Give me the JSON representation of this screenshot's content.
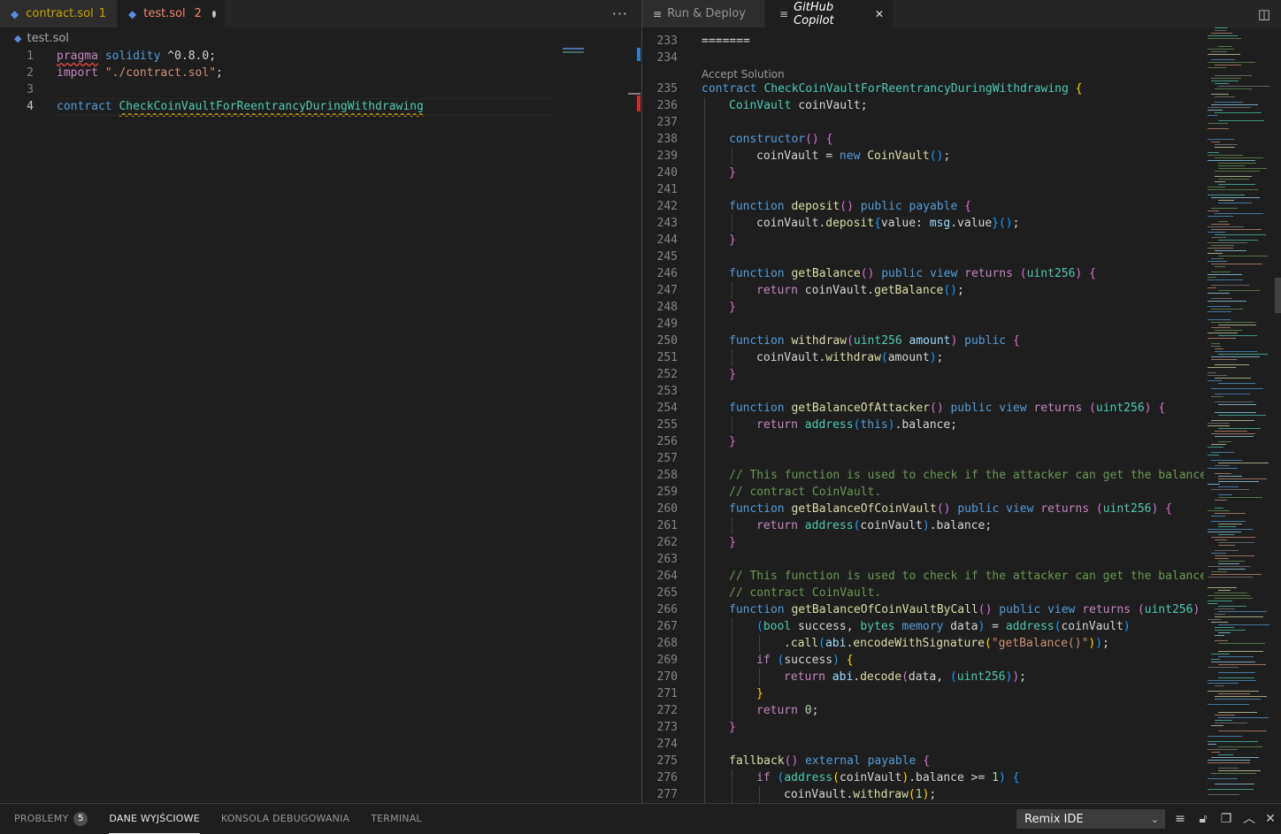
{
  "left_group": {
    "tabs": [
      {
        "label": "contract.sol",
        "count": "1",
        "active": false
      },
      {
        "label": "test.sol",
        "count": "2",
        "active": true
      }
    ],
    "more_actions": "···",
    "breadcrumb": "test.sol",
    "lines": [
      {
        "n": "1",
        "tokens": [
          [
            "kw2 squiggle-red",
            "pragma"
          ],
          [
            "plain",
            " "
          ],
          [
            "kw",
            "solidity"
          ],
          [
            "plain",
            " ^0.8.0;"
          ]
        ]
      },
      {
        "n": "2",
        "tokens": [
          [
            "kw2",
            "import"
          ],
          [
            "plain",
            " "
          ],
          [
            "str",
            "\"./contract.sol\""
          ],
          [
            "plain",
            ";"
          ]
        ]
      },
      {
        "n": "3",
        "tokens": []
      },
      {
        "n": "4",
        "tokens": [
          [
            "kw",
            "contract"
          ],
          [
            "plain",
            " "
          ],
          [
            "ty squiggle-yel",
            "CheckCoinVaultForReentrancyDuringWithdrawing"
          ]
        ]
      }
    ]
  },
  "right_group": {
    "tabs": [
      {
        "label": "Run & Deploy"
      },
      {
        "label": "GitHub Copilot"
      }
    ],
    "close_glyph": "✕",
    "split_glyph": "◫",
    "codelens": "Accept Solution",
    "lines": [
      {
        "n": "233",
        "i": 0,
        "tokens": [
          [
            "plain",
            "======="
          ]
        ]
      },
      {
        "n": "234",
        "i": 0,
        "tokens": []
      },
      {
        "n": "235",
        "i": 0,
        "tokens": [
          [
            "kw",
            "contract"
          ],
          [
            "plain",
            " "
          ],
          [
            "ty",
            "CheckCoinVaultForReentrancyDuringWithdrawing"
          ],
          [
            "plain",
            " "
          ],
          [
            "br1",
            "{"
          ]
        ]
      },
      {
        "n": "236",
        "i": 1,
        "tokens": [
          [
            "ty",
            "CoinVault"
          ],
          [
            "plain",
            " coinVault;"
          ]
        ]
      },
      {
        "n": "237",
        "i": 1,
        "tokens": []
      },
      {
        "n": "238",
        "i": 1,
        "tokens": [
          [
            "kw",
            "constructor"
          ],
          [
            "br2",
            "()"
          ],
          [
            "plain",
            " "
          ],
          [
            "br2",
            "{"
          ]
        ]
      },
      {
        "n": "239",
        "i": 2,
        "tokens": [
          [
            "plain",
            "coinVault = "
          ],
          [
            "kw",
            "new"
          ],
          [
            "plain",
            " "
          ],
          [
            "fn",
            "CoinVault"
          ],
          [
            "br3",
            "()"
          ],
          [
            "plain",
            ";"
          ]
        ]
      },
      {
        "n": "240",
        "i": 1,
        "tokens": [
          [
            "br2",
            "}"
          ]
        ]
      },
      {
        "n": "241",
        "i": 1,
        "tokens": []
      },
      {
        "n": "242",
        "i": 1,
        "tokens": [
          [
            "kw",
            "function"
          ],
          [
            "plain",
            " "
          ],
          [
            "fn",
            "deposit"
          ],
          [
            "br2",
            "()"
          ],
          [
            "plain",
            " "
          ],
          [
            "kw",
            "public"
          ],
          [
            "plain",
            " "
          ],
          [
            "kw",
            "payable"
          ],
          [
            "plain",
            " "
          ],
          [
            "br2",
            "{"
          ]
        ]
      },
      {
        "n": "243",
        "i": 2,
        "tokens": [
          [
            "plain",
            "coinVault."
          ],
          [
            "fn",
            "deposit"
          ],
          [
            "br3",
            "{"
          ],
          [
            "plain",
            "value: "
          ],
          [
            "var",
            "msg"
          ],
          [
            "plain",
            ".value"
          ],
          [
            "br3",
            "}"
          ],
          [
            "br3",
            "()"
          ],
          [
            "plain",
            ";"
          ]
        ]
      },
      {
        "n": "244",
        "i": 1,
        "tokens": [
          [
            "br2",
            "}"
          ]
        ]
      },
      {
        "n": "245",
        "i": 1,
        "tokens": []
      },
      {
        "n": "246",
        "i": 1,
        "tokens": [
          [
            "kw",
            "function"
          ],
          [
            "plain",
            " "
          ],
          [
            "fn",
            "getBalance"
          ],
          [
            "br2",
            "()"
          ],
          [
            "plain",
            " "
          ],
          [
            "kw",
            "public"
          ],
          [
            "plain",
            " "
          ],
          [
            "kw",
            "view"
          ],
          [
            "plain",
            " "
          ],
          [
            "kw2",
            "returns"
          ],
          [
            "plain",
            " "
          ],
          [
            "br2",
            "("
          ],
          [
            "ty",
            "uint256"
          ],
          [
            "br2",
            ")"
          ],
          [
            "plain",
            " "
          ],
          [
            "br2",
            "{"
          ]
        ]
      },
      {
        "n": "247",
        "i": 2,
        "tokens": [
          [
            "kw2",
            "return"
          ],
          [
            "plain",
            " coinVault."
          ],
          [
            "fn",
            "getBalance"
          ],
          [
            "br3",
            "()"
          ],
          [
            "plain",
            ";"
          ]
        ]
      },
      {
        "n": "248",
        "i": 1,
        "tokens": [
          [
            "br2",
            "}"
          ]
        ]
      },
      {
        "n": "249",
        "i": 1,
        "tokens": []
      },
      {
        "n": "250",
        "i": 1,
        "tokens": [
          [
            "kw",
            "function"
          ],
          [
            "plain",
            " "
          ],
          [
            "fn",
            "withdraw"
          ],
          [
            "br2",
            "("
          ],
          [
            "ty",
            "uint256"
          ],
          [
            "plain",
            " "
          ],
          [
            "var",
            "amount"
          ],
          [
            "br2",
            ")"
          ],
          [
            "plain",
            " "
          ],
          [
            "kw",
            "public"
          ],
          [
            "plain",
            " "
          ],
          [
            "br2",
            "{"
          ]
        ]
      },
      {
        "n": "251",
        "i": 2,
        "tokens": [
          [
            "plain",
            "coinVault."
          ],
          [
            "fn",
            "withdraw"
          ],
          [
            "br3",
            "("
          ],
          [
            "plain",
            "amount"
          ],
          [
            "br3",
            ")"
          ],
          [
            "plain",
            ";"
          ]
        ]
      },
      {
        "n": "252",
        "i": 1,
        "tokens": [
          [
            "br2",
            "}"
          ]
        ]
      },
      {
        "n": "253",
        "i": 1,
        "tokens": []
      },
      {
        "n": "254",
        "i": 1,
        "tokens": [
          [
            "kw",
            "function"
          ],
          [
            "plain",
            " "
          ],
          [
            "fn",
            "getBalanceOfAttacker"
          ],
          [
            "br2",
            "()"
          ],
          [
            "plain",
            " "
          ],
          [
            "kw",
            "public"
          ],
          [
            "plain",
            " "
          ],
          [
            "kw",
            "view"
          ],
          [
            "plain",
            " "
          ],
          [
            "kw2",
            "returns"
          ],
          [
            "plain",
            " "
          ],
          [
            "br2",
            "("
          ],
          [
            "ty",
            "uint256"
          ],
          [
            "br2",
            ")"
          ],
          [
            "plain",
            " "
          ],
          [
            "br2",
            "{"
          ]
        ]
      },
      {
        "n": "255",
        "i": 2,
        "tokens": [
          [
            "kw2",
            "return"
          ],
          [
            "plain",
            " "
          ],
          [
            "ty",
            "address"
          ],
          [
            "br3",
            "("
          ],
          [
            "kw",
            "this"
          ],
          [
            "br3",
            ")"
          ],
          [
            "plain",
            ".balance;"
          ]
        ]
      },
      {
        "n": "256",
        "i": 1,
        "tokens": [
          [
            "br2",
            "}"
          ]
        ]
      },
      {
        "n": "257",
        "i": 1,
        "tokens": []
      },
      {
        "n": "258",
        "i": 1,
        "tokens": [
          [
            "cm",
            "// This function is used to check if the attacker can get the balance of the"
          ]
        ]
      },
      {
        "n": "259",
        "i": 1,
        "tokens": [
          [
            "cm",
            "// contract CoinVault."
          ]
        ]
      },
      {
        "n": "260",
        "i": 1,
        "tokens": [
          [
            "kw",
            "function"
          ],
          [
            "plain",
            " "
          ],
          [
            "fn",
            "getBalanceOfCoinVault"
          ],
          [
            "br2",
            "()"
          ],
          [
            "plain",
            " "
          ],
          [
            "kw",
            "public"
          ],
          [
            "plain",
            " "
          ],
          [
            "kw",
            "view"
          ],
          [
            "plain",
            " "
          ],
          [
            "kw2",
            "returns"
          ],
          [
            "plain",
            " "
          ],
          [
            "br2",
            "("
          ],
          [
            "ty",
            "uint256"
          ],
          [
            "br2",
            ")"
          ],
          [
            "plain",
            " "
          ],
          [
            "br2",
            "{"
          ]
        ]
      },
      {
        "n": "261",
        "i": 2,
        "tokens": [
          [
            "kw2",
            "return"
          ],
          [
            "plain",
            " "
          ],
          [
            "ty",
            "address"
          ],
          [
            "br3",
            "("
          ],
          [
            "plain",
            "coinVault"
          ],
          [
            "br3",
            ")"
          ],
          [
            "plain",
            ".balance;"
          ]
        ]
      },
      {
        "n": "262",
        "i": 1,
        "tokens": [
          [
            "br2",
            "}"
          ]
        ]
      },
      {
        "n": "263",
        "i": 1,
        "tokens": []
      },
      {
        "n": "264",
        "i": 1,
        "tokens": [
          [
            "cm",
            "// This function is used to check if the attacker can get the balance of the"
          ]
        ]
      },
      {
        "n": "265",
        "i": 1,
        "tokens": [
          [
            "cm",
            "// contract CoinVault."
          ]
        ]
      },
      {
        "n": "266",
        "i": 1,
        "tokens": [
          [
            "kw",
            "function"
          ],
          [
            "plain",
            " "
          ],
          [
            "fn",
            "getBalanceOfCoinVaultByCall"
          ],
          [
            "br2",
            "()"
          ],
          [
            "plain",
            " "
          ],
          [
            "kw",
            "public"
          ],
          [
            "plain",
            " "
          ],
          [
            "kw",
            "view"
          ],
          [
            "plain",
            " "
          ],
          [
            "kw2",
            "returns"
          ],
          [
            "plain",
            " "
          ],
          [
            "br2",
            "("
          ],
          [
            "ty",
            "uint256"
          ],
          [
            "br2",
            ")"
          ],
          [
            "plain",
            " "
          ],
          [
            "br2",
            "{"
          ]
        ]
      },
      {
        "n": "267",
        "i": 2,
        "tokens": [
          [
            "br3",
            "("
          ],
          [
            "ty",
            "bool"
          ],
          [
            "plain",
            " success, "
          ],
          [
            "ty",
            "bytes"
          ],
          [
            "plain",
            " "
          ],
          [
            "kw",
            "memory"
          ],
          [
            "plain",
            " data"
          ],
          [
            "br3",
            ")"
          ],
          [
            "plain",
            " = "
          ],
          [
            "ty",
            "address"
          ],
          [
            "br3",
            "("
          ],
          [
            "plain",
            "coinVault"
          ],
          [
            "br3",
            ")"
          ]
        ]
      },
      {
        "n": "268",
        "i": 3,
        "tokens": [
          [
            "plain",
            "."
          ],
          [
            "fn",
            "call"
          ],
          [
            "br3",
            "("
          ],
          [
            "var",
            "abi"
          ],
          [
            "plain",
            "."
          ],
          [
            "fn",
            "encodeWithSignature"
          ],
          [
            "br1",
            "("
          ],
          [
            "str",
            "\"getBalance()\""
          ],
          [
            "br1",
            ")"
          ],
          [
            "br3",
            ")"
          ],
          [
            "plain",
            ";"
          ]
        ]
      },
      {
        "n": "269",
        "i": 2,
        "tokens": [
          [
            "kw2",
            "if"
          ],
          [
            "plain",
            " "
          ],
          [
            "br3",
            "("
          ],
          [
            "plain",
            "success"
          ],
          [
            "br3",
            ")"
          ],
          [
            "plain",
            " "
          ],
          [
            "br1",
            "{"
          ]
        ]
      },
      {
        "n": "270",
        "i": 3,
        "tokens": [
          [
            "kw2",
            "return"
          ],
          [
            "plain",
            " "
          ],
          [
            "var",
            "abi"
          ],
          [
            "plain",
            "."
          ],
          [
            "fn",
            "decode"
          ],
          [
            "br2",
            "("
          ],
          [
            "plain",
            "data, "
          ],
          [
            "br3",
            "("
          ],
          [
            "ty",
            "uint256"
          ],
          [
            "br3",
            ")"
          ],
          [
            "br2",
            ")"
          ],
          [
            "plain",
            ";"
          ]
        ]
      },
      {
        "n": "271",
        "i": 2,
        "tokens": [
          [
            "br1",
            "}"
          ]
        ]
      },
      {
        "n": "272",
        "i": 2,
        "tokens": [
          [
            "kw2",
            "return"
          ],
          [
            "plain",
            " "
          ],
          [
            "num",
            "0"
          ],
          [
            "plain",
            ";"
          ]
        ]
      },
      {
        "n": "273",
        "i": 1,
        "tokens": [
          [
            "br2",
            "}"
          ]
        ]
      },
      {
        "n": "274",
        "i": 1,
        "tokens": []
      },
      {
        "n": "275",
        "i": 1,
        "tokens": [
          [
            "fn",
            "fallback"
          ],
          [
            "br2",
            "()"
          ],
          [
            "plain",
            " "
          ],
          [
            "kw",
            "external"
          ],
          [
            "plain",
            " "
          ],
          [
            "kw",
            "payable"
          ],
          [
            "plain",
            " "
          ],
          [
            "br2",
            "{"
          ]
        ]
      },
      {
        "n": "276",
        "i": 2,
        "tokens": [
          [
            "kw2",
            "if"
          ],
          [
            "plain",
            " "
          ],
          [
            "br3",
            "("
          ],
          [
            "ty",
            "address"
          ],
          [
            "br1",
            "("
          ],
          [
            "plain",
            "coinVault"
          ],
          [
            "br1",
            ")"
          ],
          [
            "plain",
            ".balance >= "
          ],
          [
            "num",
            "1"
          ],
          [
            "br3",
            ")"
          ],
          [
            "plain",
            " "
          ],
          [
            "br3",
            "{"
          ]
        ]
      },
      {
        "n": "277",
        "i": 3,
        "tokens": [
          [
            "plain",
            "coinVault."
          ],
          [
            "fn",
            "withdraw"
          ],
          [
            "br1",
            "("
          ],
          [
            "num",
            "1"
          ],
          [
            "br1",
            ")"
          ],
          [
            "plain",
            ";"
          ]
        ]
      }
    ]
  },
  "panel": {
    "tabs": [
      {
        "label": "PROBLEMY",
        "badge": "5"
      },
      {
        "label": "DANE WYJŚCIOWE"
      },
      {
        "label": "KONSOLA DEBUGOWANIA"
      },
      {
        "label": "TERMINAL"
      }
    ],
    "output_channel": "Remix IDE"
  }
}
